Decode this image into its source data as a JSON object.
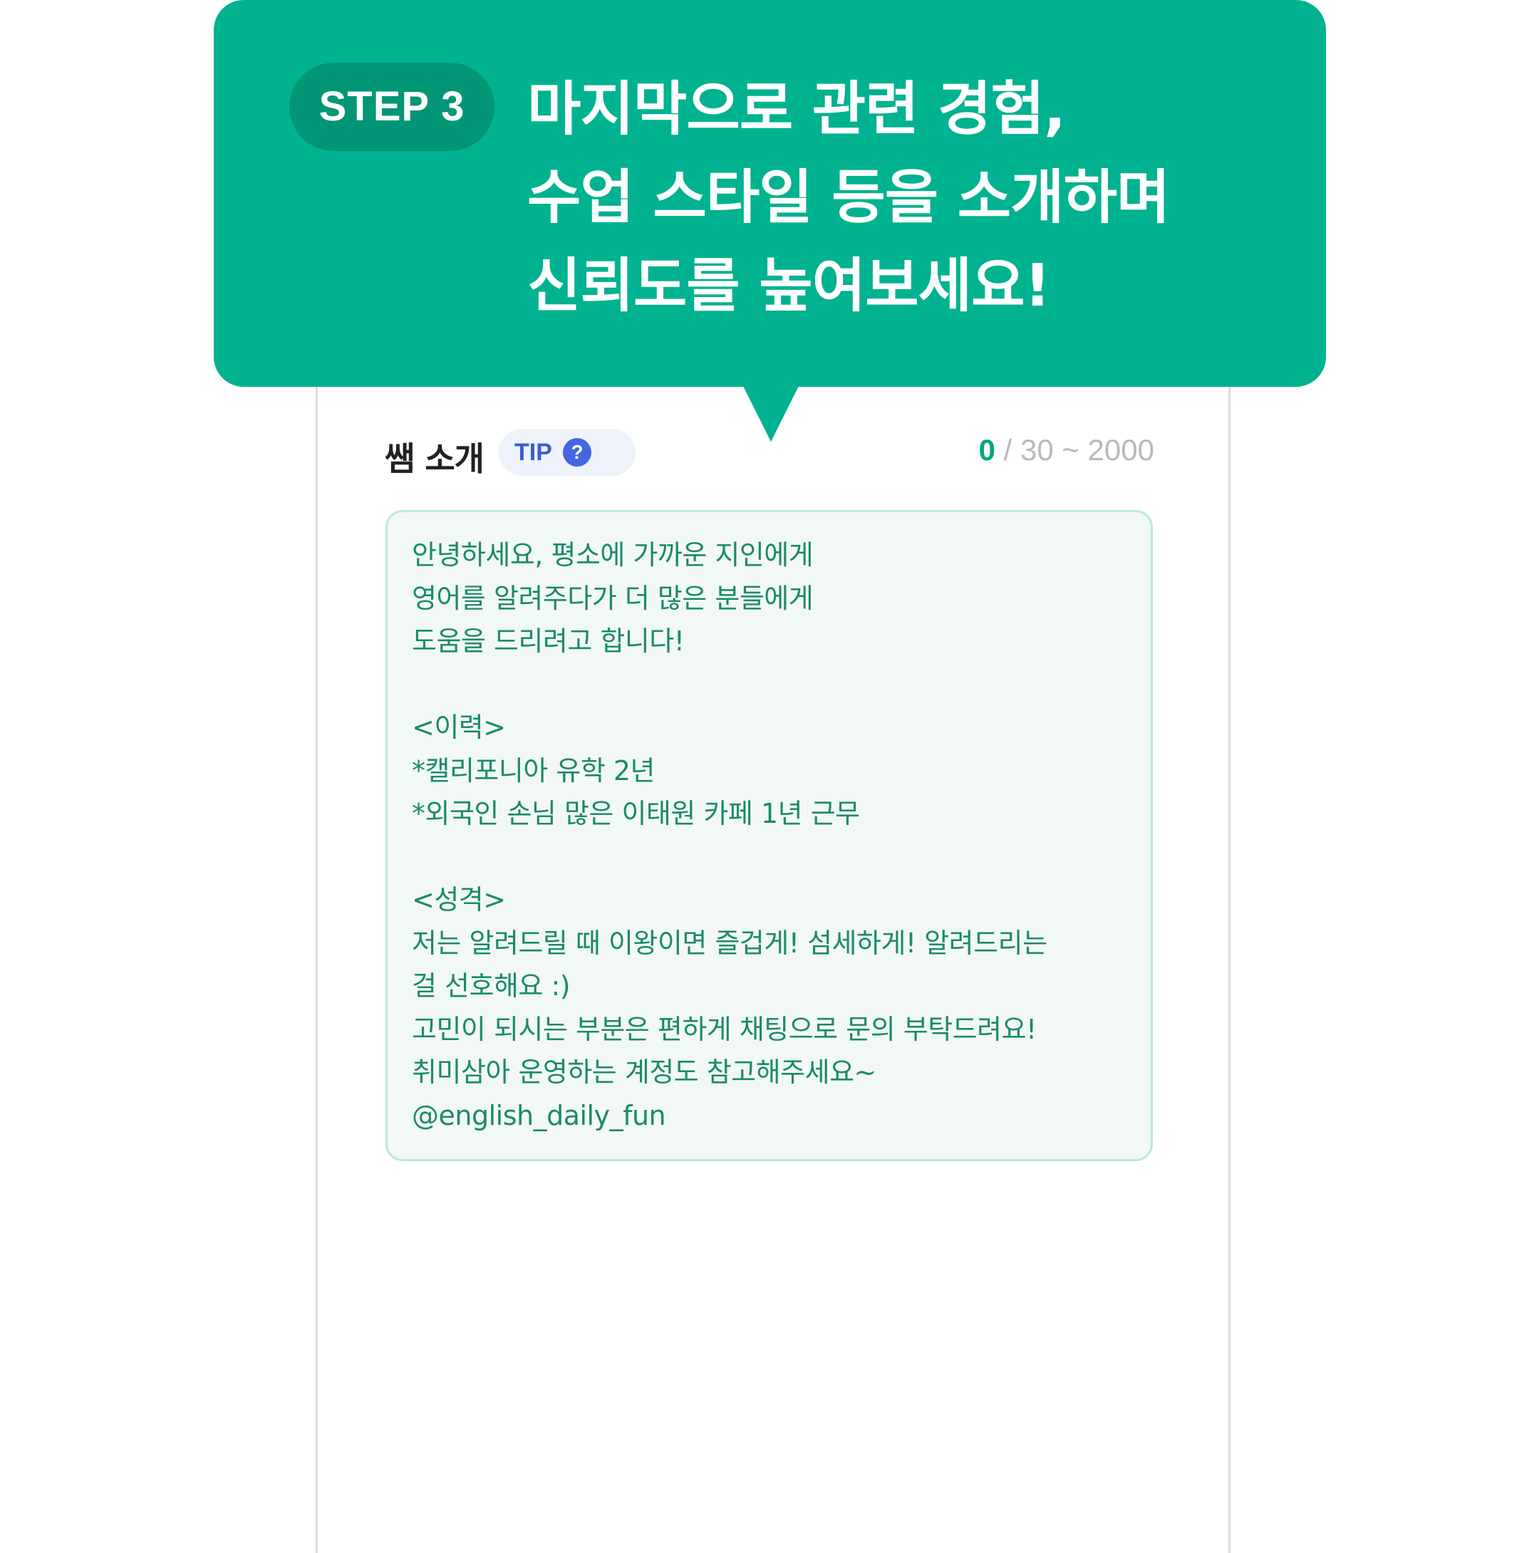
{
  "banner": {
    "step_label": "STEP 3",
    "headline_lines": [
      "마지막으로 관련 경험,",
      "수업 스타일 등을 소개하며",
      "신뢰도를 높여보세요!"
    ]
  },
  "field": {
    "label": "쌤 소개",
    "tip_label": "TIP",
    "tip_icon": "question-circle-icon",
    "char_count": "0",
    "char_limit": "/ 30 ~ 2000"
  },
  "intro_text": {
    "lines": [
      "안녕하세요, 평소에 가까운 지인에게",
      "영어를 알려주다가  더 많은 분들에게",
      "도움을 드리려고 합니다!",
      "",
      "<이력>",
      "*캘리포니아 유학 2년",
      "*외국인 손님 많은 이태원 카페 1년 근무",
      "",
      "<성격>",
      "저는 알려드릴 때 이왕이면 즐겁게! 섬세하게! 알려드리는",
      "걸 선호해요 :)",
      "고민이 되시는 부분은 편하게 채팅으로 문의 부탁드려요!",
      "취미삼아 운영하는 계정도 참고해주세요~",
      "@english_daily_fun"
    ]
  },
  "colors": {
    "brand_green": "#00b290",
    "badge_green": "#009676",
    "text_green": "#1a8a6a",
    "tip_blue": "#3d5bd1"
  }
}
